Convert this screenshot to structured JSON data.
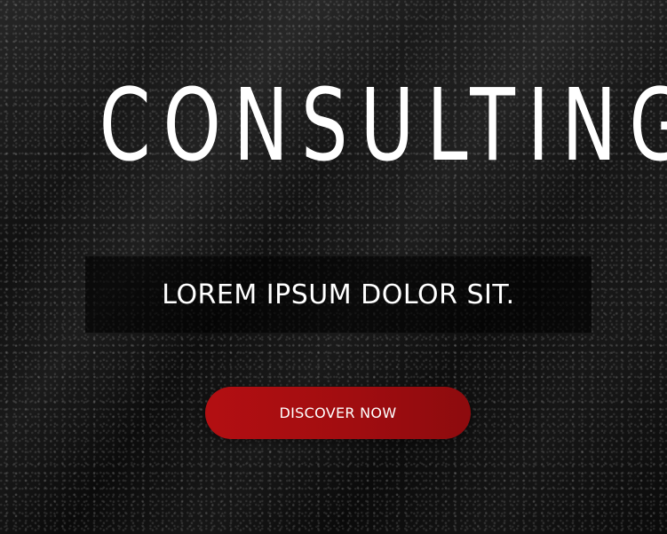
{
  "hero": {
    "headline": "CONSULTING",
    "tagline": "LOREM IPSUM DOLOR SIT.",
    "cta_label": "DISCOVER NOW"
  },
  "colors": {
    "background": "#0d0d0d",
    "accent": "#a50e11",
    "text": "#ffffff"
  }
}
